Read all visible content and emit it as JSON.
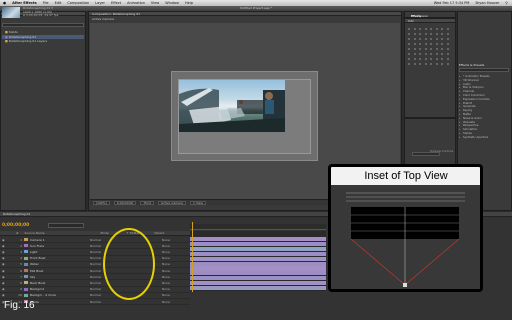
{
  "menubar": {
    "app": "After Effects",
    "items": [
      "File",
      "Edit",
      "Composition",
      "Layer",
      "Effect",
      "Animation",
      "View",
      "Window",
      "Help"
    ],
    "clock": "Wed Feb 17  5:34 PM",
    "user": "Bryan Hoover"
  },
  "window": {
    "title": "Untitled Project.aep *"
  },
  "project": {
    "tab": "Project",
    "thumb_info": [
      "Rotationsphing 01 ▾",
      "1920 x 1080 (1.00)",
      "Δ 0;00;00;03, 29.97 fps"
    ],
    "items": [
      {
        "name": "Solids"
      },
      {
        "name": "Rotationsphing 01"
      },
      {
        "name": "Rotationsphing 01 Layers"
      }
    ],
    "selected_index": 1
  },
  "composition": {
    "tab": "Composition: Rotationsphing 01",
    "view_label": "Active Camera",
    "footer": [
      "(100%)",
      "0;00;00;00",
      "Third",
      "Active Camera",
      "1 View"
    ]
  },
  "workspace": {
    "label": "Workspace:",
    "value": "Effects"
  },
  "info_panel": {
    "tab": "Info",
    "controls": "Preview Controls"
  },
  "effects_panel": {
    "tab": "Effects & Presets",
    "categories": [
      "* Animation Presets",
      "3D Channel",
      "Audio",
      "Blur & Sharpen",
      "Channel",
      "Color Correction",
      "Expression Controls",
      "Distort",
      "Generate",
      "Keying",
      "Matte",
      "Noise & Grain",
      "Obsolete",
      "Perspective",
      "Simulation",
      "Stylize",
      "Synthetic Aperture"
    ]
  },
  "timeline": {
    "tab": "Rotationsphing 01",
    "timecode": "0;00;00;00",
    "header": [
      "#",
      "Source Name",
      "Mode",
      "T TrkMat",
      "Parent"
    ],
    "layers": [
      {
        "num": "1",
        "name": "Camera 1",
        "color": "#c49c5d"
      },
      {
        "num": "2",
        "name": "Sun Flare",
        "color": "#a16fc1"
      },
      {
        "num": "3",
        "name": "Light",
        "color": "#6fa0c6"
      },
      {
        "num": "4",
        "name": "Front Boat",
        "color": "#7fb66d"
      },
      {
        "num": "5",
        "name": "Water",
        "color": "#5c8bb7"
      },
      {
        "num": "6",
        "name": "Mid Boat",
        "color": "#b7735c"
      },
      {
        "num": "7",
        "name": "Sky",
        "color": "#6a9ab5"
      },
      {
        "num": "8",
        "name": "Back Boat",
        "color": "#b6b36d"
      },
      {
        "num": "9",
        "name": "Backgrnd",
        "color": "#8b6fc1"
      },
      {
        "num": "10",
        "name": "Backgrn - 4 more",
        "color": "#6dae9a"
      },
      {
        "num": "11",
        "name": "Guide",
        "color": "#c07faa"
      }
    ],
    "modes": [
      "Normal",
      "Normal",
      "Normal",
      "Normal",
      "Normal",
      "Normal",
      "Normal",
      "Normal",
      "Normal",
      "Normal",
      "Normal"
    ],
    "parents": [
      "None",
      "None",
      "None",
      "None",
      "None",
      "None",
      "None",
      "None",
      "None",
      "None",
      "None"
    ],
    "track_colors": [
      "#a58dc5",
      "#9b8ec6",
      "#8fa2c4",
      "#9d8fc5",
      "#a091c6",
      "#9a8ec2",
      "#a290c4",
      "#9c8ec4",
      "#9b90c3",
      "#a38fc5",
      "#969cc1"
    ]
  },
  "inset": {
    "title": "Inset of Top View"
  },
  "figure_label": "Fig. 16",
  "colors": {
    "highlight_oval": "#e5d000",
    "timecode": "#e3a20e",
    "playhead": "#d4a020"
  }
}
